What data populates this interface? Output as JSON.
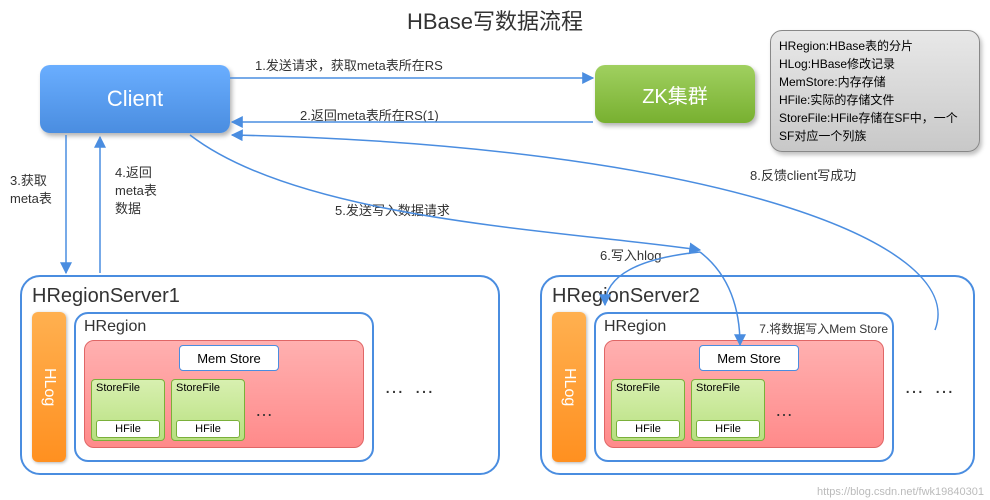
{
  "title": "HBase写数据流程",
  "client": "Client",
  "zk": "ZK集群",
  "legend": {
    "l1": "HRegion:HBase表的分片",
    "l2": "HLog:HBase修改记录",
    "l3": "MemStore:内存存储",
    "l4": "HFile:实际的存储文件",
    "l5": "StoreFile:HFile存储在SF中，一个SF对应一个列族"
  },
  "rs1": {
    "name": "HRegionServer1",
    "hlog": "HLog",
    "hregion": "HRegion",
    "memstore": "Mem Store",
    "storefile": "StoreFile",
    "hfile": "HFile",
    "dots": "…"
  },
  "rs2": {
    "name": "HRegionServer2",
    "hlog": "HLog",
    "hregion": "HRegion",
    "memstore": "Mem Store",
    "storefile": "StoreFile",
    "hfile": "HFile",
    "dots": "…"
  },
  "steps": {
    "s1": "1.发送请求，获取meta表所在RS",
    "s2": "2.返回meta表所在RS(1)",
    "s3a": "3.获取",
    "s3b": "meta表",
    "s4a": "4.返回",
    "s4b": "meta表",
    "s4c": "数据",
    "s5": "5.发送写入数据请求",
    "s6": "6.写入hlog",
    "s7": "7.将数据写入Mem Store",
    "s8": "8.反馈client写成功"
  },
  "watermark": "https://blog.csdn.net/fwk19840301"
}
